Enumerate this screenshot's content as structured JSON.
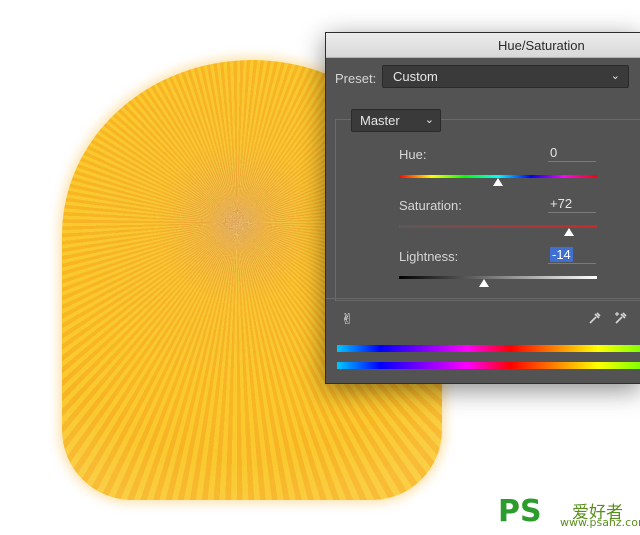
{
  "dialog": {
    "title": "Hue/Saturation",
    "preset_label": "Preset:",
    "preset_value": "Custom",
    "channel_value": "Master",
    "hue": {
      "label": "Hue:",
      "value": "0",
      "level": 0.5
    },
    "saturation": {
      "label": "Saturation:",
      "value": "+72",
      "level": 0.86
    },
    "lightness": {
      "label": "Lightness:",
      "value": "-14",
      "level": 0.43
    },
    "icons": [
      "hand-target-icon",
      "eyedropper-icon",
      "eyedropper-plus-icon"
    ]
  },
  "watermark": {
    "logo": "PS",
    "chinese": "爱好者",
    "url": "www.psahz.com"
  },
  "colors": {
    "fur": "#f7b52c",
    "dialog_bg": "#535353",
    "field_bg": "#3a3a3a",
    "highlight": "#3f6fd1"
  }
}
